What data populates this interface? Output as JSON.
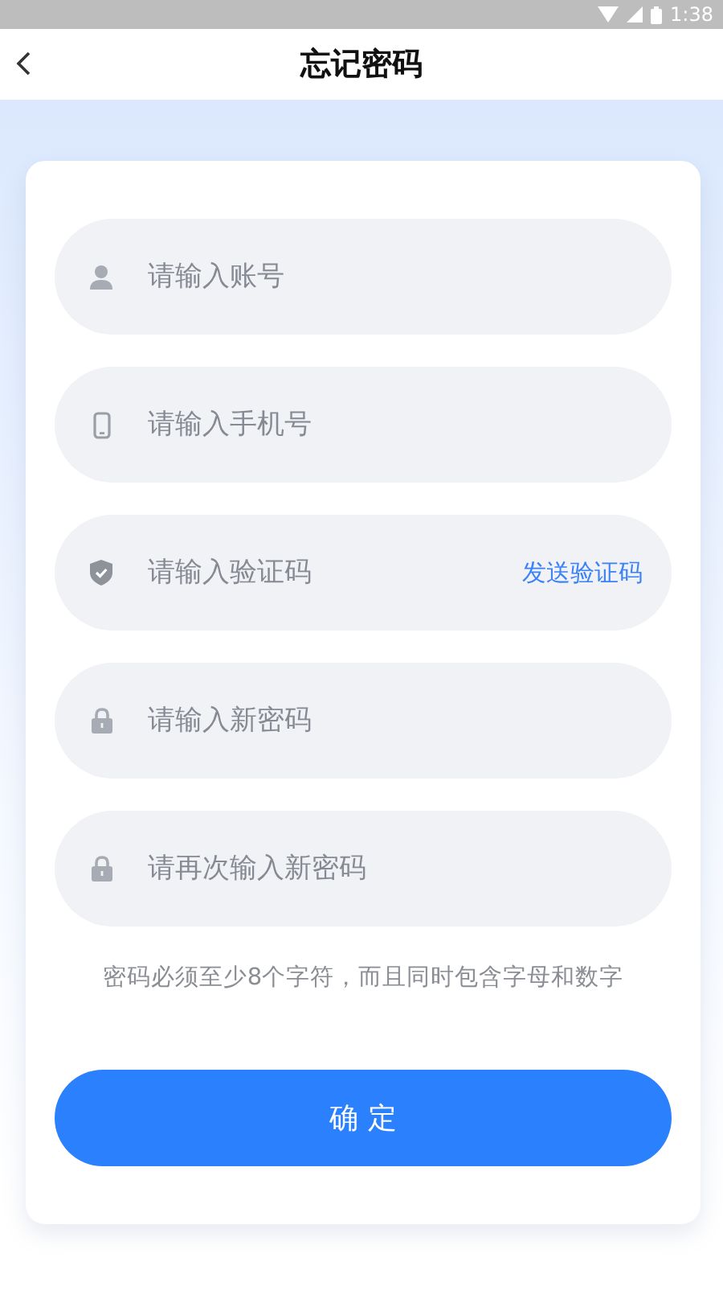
{
  "status_bar": {
    "time": "1:38"
  },
  "header": {
    "title": "忘记密码"
  },
  "fields": [
    {
      "kind": "person",
      "placeholder": "请输入账号"
    },
    {
      "kind": "phone",
      "placeholder": "请输入手机号"
    },
    {
      "kind": "shield",
      "placeholder": "请输入验证码",
      "action": "发送验证码"
    },
    {
      "kind": "lock",
      "placeholder": "请输入新密码"
    },
    {
      "kind": "lock",
      "placeholder": "请再次输入新密码"
    }
  ],
  "hint": "密码必须至少8个字符，而且同时包含字母和数字",
  "submit_button": "确 定"
}
